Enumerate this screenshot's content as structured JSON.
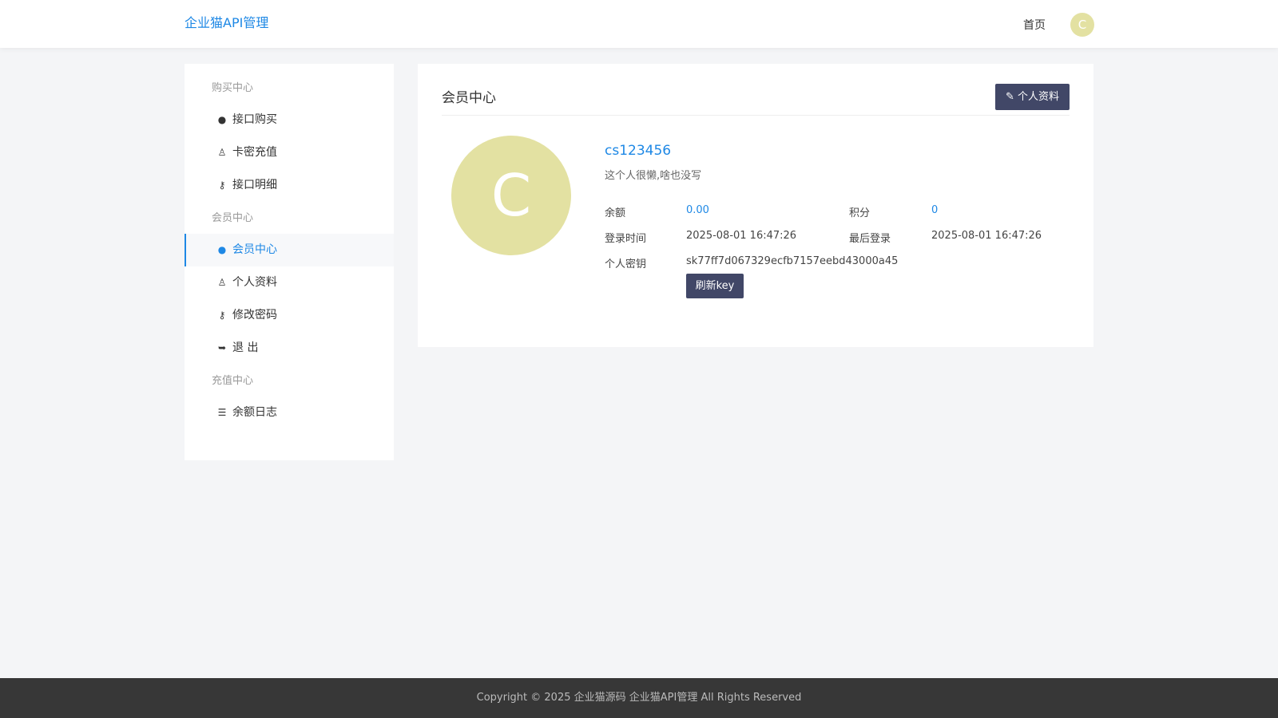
{
  "header": {
    "logo": "企业猫API管理",
    "nav_home": "首页",
    "avatar_letter": "C"
  },
  "sidebar": {
    "sections": [
      {
        "title": "购买中心",
        "items": [
          {
            "label": "接口购买",
            "icon": "user-circle-icon"
          },
          {
            "label": "卡密充值",
            "icon": "user-outline-icon"
          },
          {
            "label": "接口明细",
            "icon": "key-icon"
          }
        ]
      },
      {
        "title": "会员中心",
        "items": [
          {
            "label": "会员中心",
            "icon": "user-circle-icon",
            "active": true
          },
          {
            "label": "个人资料",
            "icon": "user-outline-icon"
          },
          {
            "label": "修改密码",
            "icon": "key-icon"
          },
          {
            "label": "退 出",
            "icon": "sign-out-icon"
          }
        ]
      },
      {
        "title": "充值中心",
        "items": [
          {
            "label": "余额日志",
            "icon": "list-icon"
          }
        ]
      }
    ]
  },
  "main": {
    "title": "会员中心",
    "profile_button": "个人资料",
    "avatar_letter": "C",
    "username": "cs123456",
    "bio": "这个人很懒,啥也没写",
    "balance_label": "余额",
    "balance": "0.00",
    "points_label": "积分",
    "points": "0",
    "login_time_label": "登录时间",
    "login_time": "2025-08-01 16:47:26",
    "last_login_label": "最后登录",
    "last_login": "2025-08-01 16:47:26",
    "key_label": "个人密钥",
    "key": "sk77ff7d067329ecfb7157eebd43000a45",
    "refresh_button": "刷新key"
  },
  "footer": {
    "text": "Copyright © 2025 企业猫源码 企业猫API管理 All Rights Reserved"
  },
  "colors": {
    "accent": "#1e88e5",
    "button": "#414767",
    "avatar": "#e3e1a2",
    "footer": "#373737"
  }
}
